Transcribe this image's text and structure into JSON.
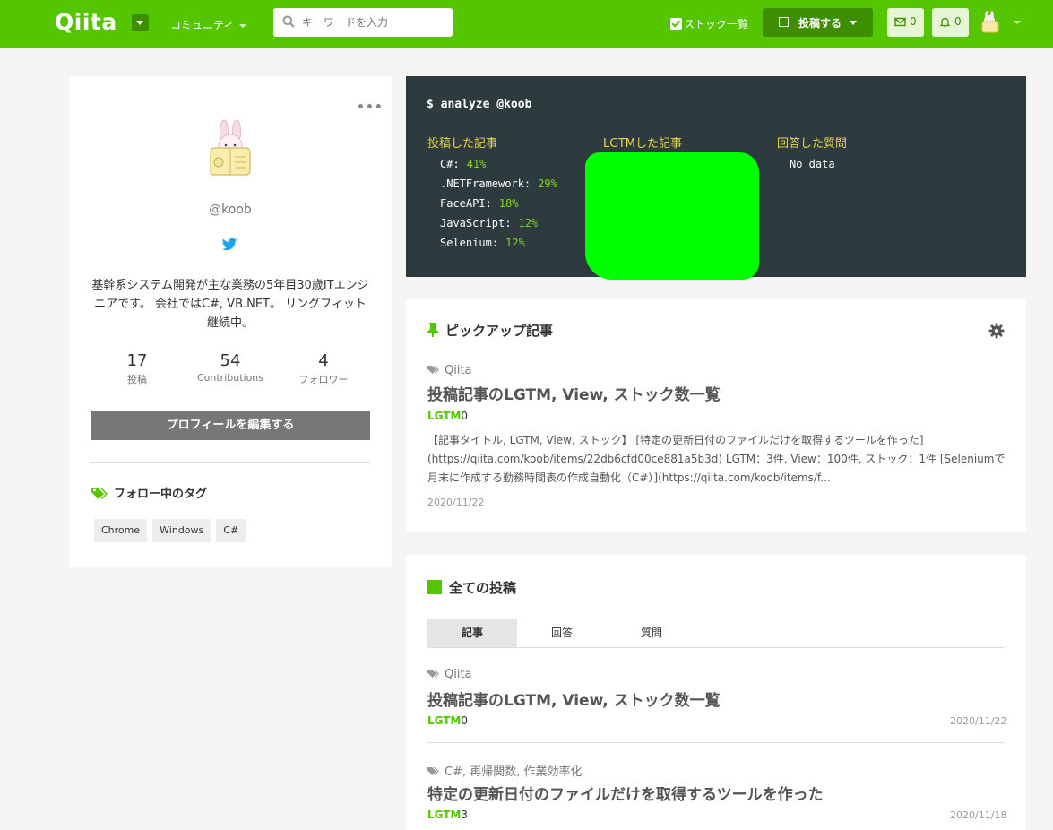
{
  "header": {
    "logo": "Qiita",
    "community": "コミュニティ",
    "search_placeholder": "キーワードを入力",
    "stock_list": "ストック一覧",
    "post_button": "投稿する",
    "mail_count": "0",
    "notification_count": "0",
    "colors": {
      "brand": "#55c500",
      "brand_dark": "#3e8f00"
    }
  },
  "profile": {
    "username": "@koob",
    "bio": "基幹系システム開発が主な業務の5年目30歳ITエンジニアです。 会社ではC#, VB.NET。 リングフィット継続中。",
    "stats": [
      {
        "num": "17",
        "label": "投稿"
      },
      {
        "num": "54",
        "label": "Contributions"
      },
      {
        "num": "4",
        "label": "フォロワー"
      }
    ],
    "edit_button": "プロフィールを編集する",
    "following_tags_heading": "フォロー中のタグ",
    "tags": [
      "Chrome",
      "Windows",
      "C#"
    ]
  },
  "analyze": {
    "command": "$ analyze @koob",
    "posted_heading": "投稿した記事",
    "lgtm_heading": "LGTMした記事",
    "answered_heading": "回答した質問",
    "posted": [
      {
        "name": "C#:",
        "pct": "41%"
      },
      {
        "name": ".NETFramework:",
        "pct": "29%"
      },
      {
        "name": "FaceAPI:",
        "pct": "18%"
      },
      {
        "name": "JavaScript:",
        "pct": "12%"
      },
      {
        "name": "Selenium:",
        "pct": "12%"
      }
    ],
    "answered_empty": "No data"
  },
  "pickup": {
    "heading": "ピックアップ記事",
    "article": {
      "tags": "Qiita",
      "title": "投稿記事のLGTM, View, ストック数一覧",
      "lgtm_label": "LGTM",
      "lgtm_count": "0",
      "excerpt": "【記事タイトル, LGTM, View, ストック】 [特定の更新日付のファイルだけを取得するツールを作った](https://qiita.com/koob/items/22db6cfd00ce881a5b3d) LGTM：3件, View：100件, ストック：1件 [Seleniumで月末に作成する勤務時間表の作成自動化（C#）](https://qiita.com/koob/items/f...",
      "date": "2020/11/22"
    }
  },
  "all_posts": {
    "heading": "全ての投稿",
    "tabs": [
      "記事",
      "回答",
      "質問"
    ],
    "items": [
      {
        "tags": "Qiita",
        "title": "投稿記事のLGTM, View, ストック数一覧",
        "lgtm_label": "LGTM",
        "lgtm_count": "0",
        "date": "2020/11/22"
      },
      {
        "tags": "C#,  再帰関数,  作業効率化",
        "title": "特定の更新日付のファイルだけを取得するツールを作った",
        "lgtm_label": "LGTM",
        "lgtm_count": "3",
        "date": "2020/11/18"
      }
    ]
  }
}
